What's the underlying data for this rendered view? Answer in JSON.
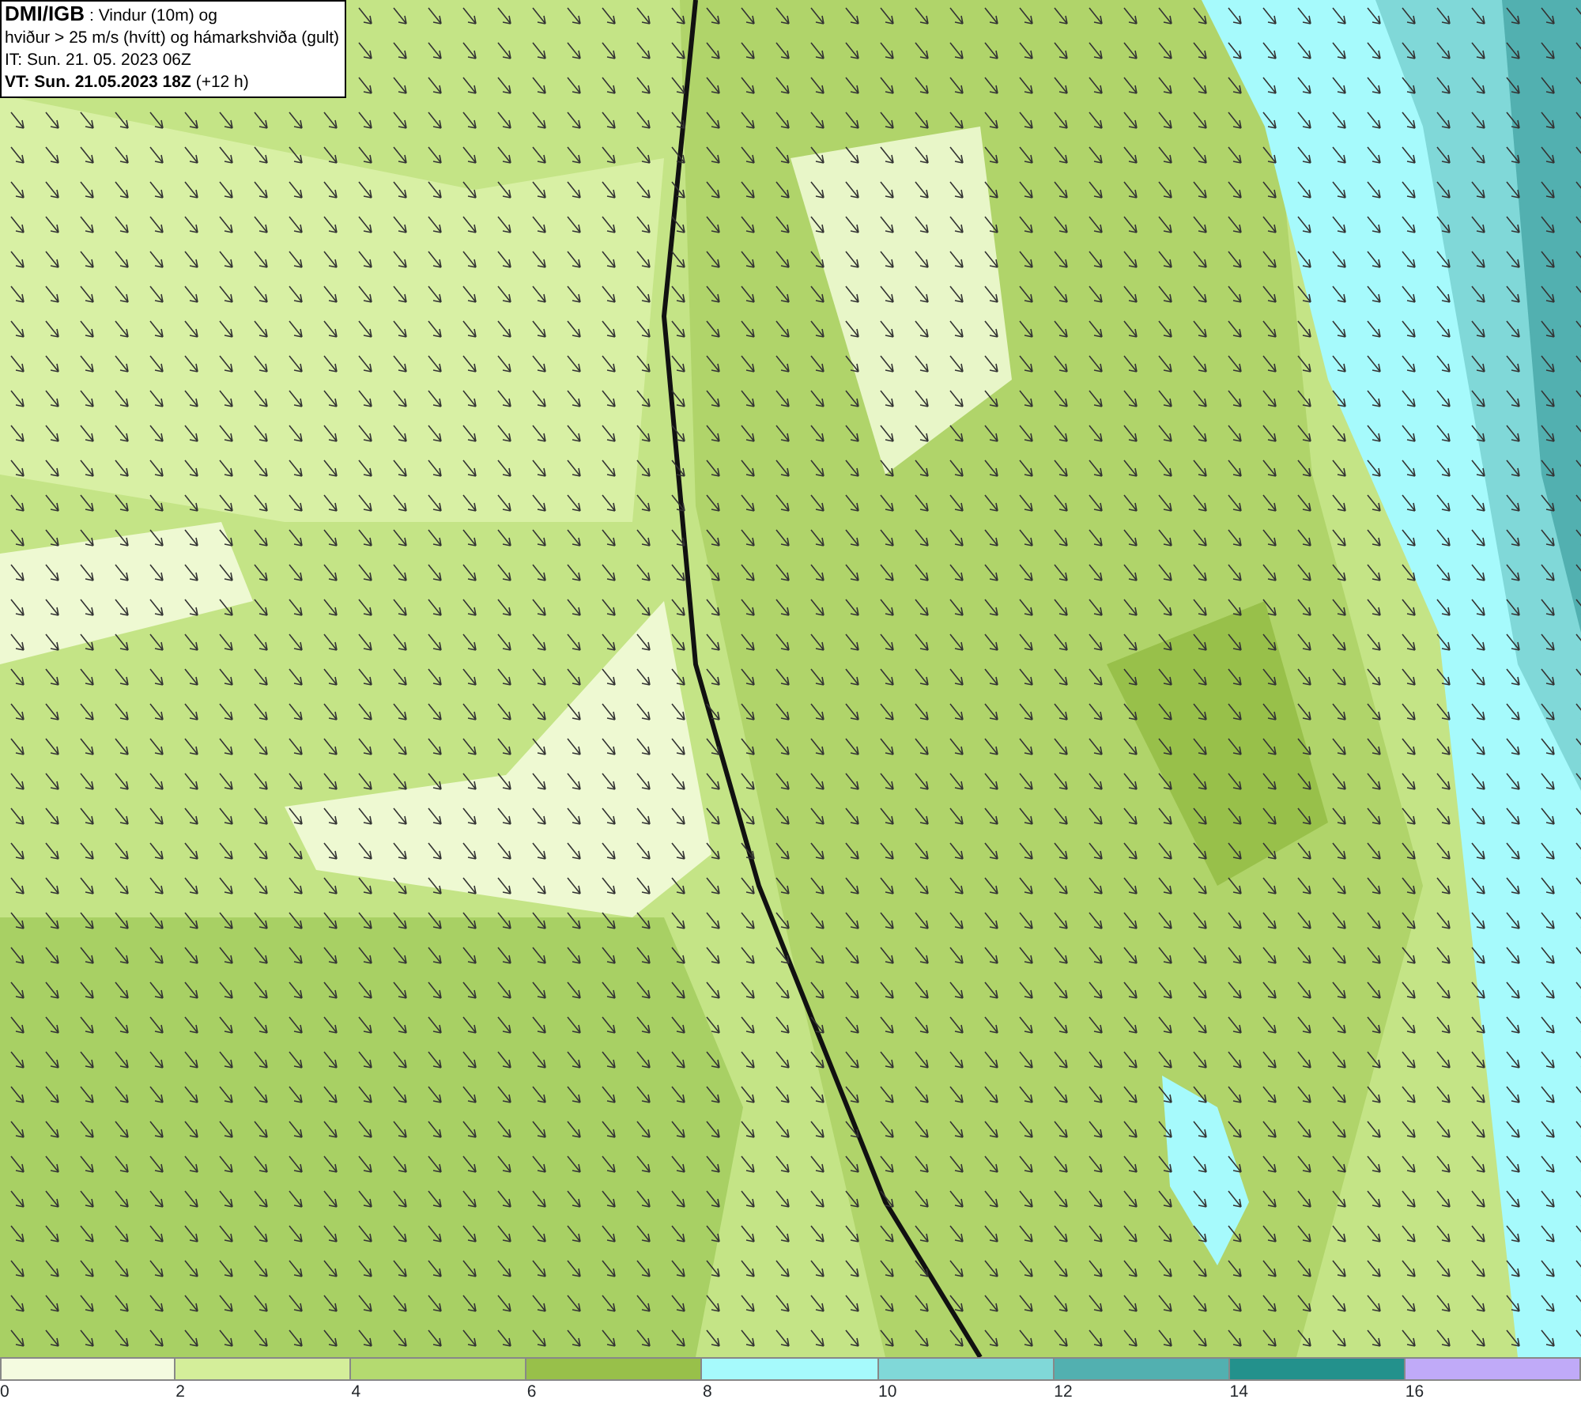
{
  "title_box": {
    "lines": [
      "**DMI/IGB** : Vindur (10m) og",
      "hviður > 25 m/s (hvítt) og hámarkshviða (gult)",
      "IT: Sun. 21. 05. 2023 06Z",
      "**VT: Sun. 21.05.2023 18Z** (+12 h)"
    ]
  },
  "legend": {
    "segments": [
      {
        "color": "#f4fbe0",
        "label": "0"
      },
      {
        "color": "#d4ee9a",
        "label": "2"
      },
      {
        "color": "#b4da70",
        "label": "4"
      },
      {
        "color": "#98c04a",
        "label": "6"
      },
      {
        "color": "#a6fafc",
        "label": "8"
      },
      {
        "color": "#80d8d8",
        "label": "10"
      },
      {
        "color": "#52b0b0",
        "label": "12"
      },
      {
        "color": "#23918c",
        "label": "14"
      },
      {
        "color": "#c0aaf8",
        "label": "16"
      }
    ]
  }
}
